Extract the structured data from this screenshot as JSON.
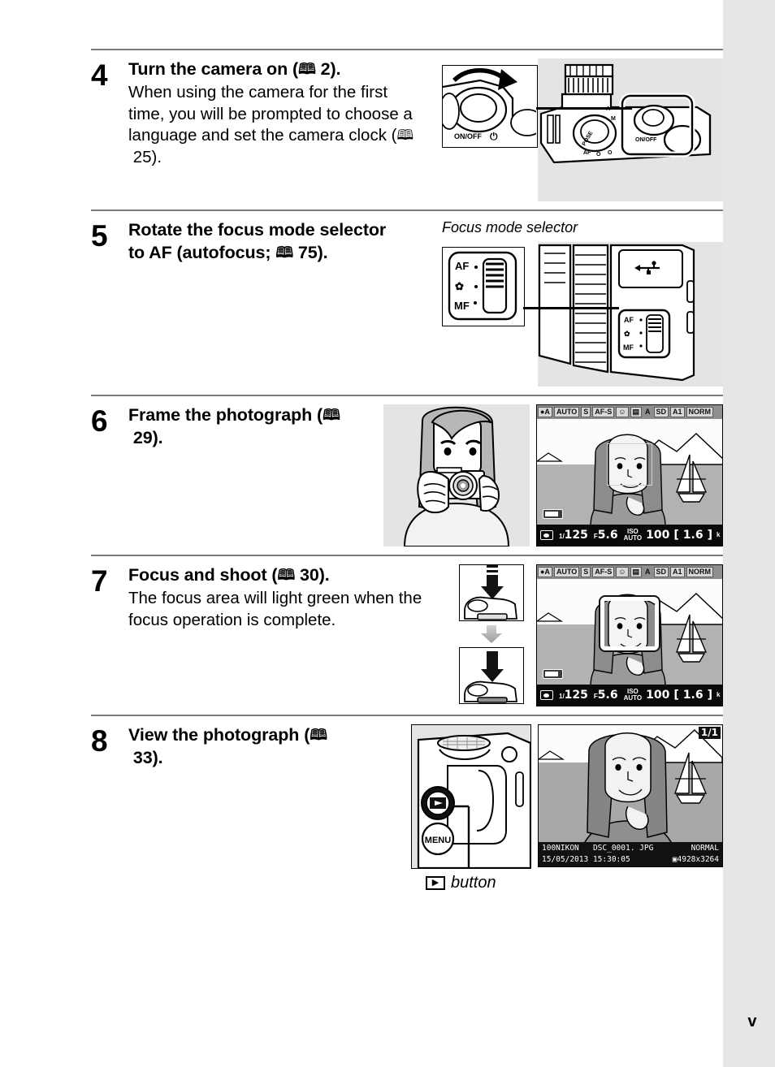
{
  "page": {
    "number": "v",
    "margin_color": "#e6e6e6"
  },
  "steps": [
    {
      "number": "4",
      "heading": "Turn the camera on (",
      "heading_ref": "2",
      "heading_tail": ").",
      "body": "When using the camera for the first time, you will be prompted to choose a language and set the camera clock (",
      "body_ref": "25",
      "body_tail": ").",
      "figure_caption": "",
      "figure": {
        "name": "camera-top-power-switch",
        "callout_label": "ON/OFF",
        "mode_dial_marks": "AUTO M S A"
      }
    },
    {
      "number": "5",
      "heading": "Rotate the focus mode selector to AF (autofocus; ",
      "heading_ref": "75",
      "heading_tail": ").",
      "body": "",
      "body_ref": "",
      "body_tail": "",
      "figure_caption": "Focus mode selector",
      "figure": {
        "name": "focus-mode-selector",
        "positions": [
          "AF",
          "macro",
          "MF"
        ],
        "usb_icon": "usb-icon"
      }
    },
    {
      "number": "6",
      "heading": "Frame the photograph (",
      "heading_ref": "29",
      "heading_tail": ").",
      "body": "",
      "body_ref": "",
      "body_tail": "",
      "figure_caption": "",
      "figure": {
        "name": "framing-photographer-and-live-view"
      }
    },
    {
      "number": "7",
      "heading": "Focus and shoot (",
      "heading_ref": "30",
      "heading_tail": ").",
      "body": "The focus area will light green when the focus operation is complete.",
      "body_ref": "",
      "body_tail": "",
      "figure_caption": "",
      "figure": {
        "name": "shutter-release-press-and-live-view"
      }
    },
    {
      "number": "8",
      "heading": "View the photograph (",
      "heading_ref": "33",
      "heading_tail": ").",
      "body": "",
      "body_ref": "",
      "body_tail": "",
      "figure_caption": "",
      "figure": {
        "name": "playback-button-and-image-review",
        "button_label": "button",
        "menu_button_label": "MENU"
      }
    }
  ],
  "live_view": {
    "status_icons": [
      {
        "name": "auto-mode-icon",
        "label": "AUTO"
      },
      {
        "name": "flash-auto-icon",
        "label": "AUTO"
      },
      {
        "name": "release-mode-single-icon",
        "label": "S"
      },
      {
        "name": "focus-mode-af-s-icon",
        "label": "AF-S"
      },
      {
        "name": "face-detection-icon",
        "label": ""
      },
      {
        "name": "af-area-mode-icon",
        "label": ""
      },
      {
        "name": "metering-auto-icon",
        "label": "A"
      },
      {
        "name": "memory-card-sd-icon",
        "label": "SD"
      },
      {
        "name": "white-balance-auto-icon",
        "label": "A1"
      },
      {
        "name": "image-quality-icon",
        "label": "NORM"
      }
    ],
    "bottom_bar": {
      "metering_icon": "metering-icon",
      "shutter_speed_prefix": "1/",
      "shutter_speed": "125",
      "aperture_prefix": "F",
      "aperture": "5.6",
      "iso_label": "ISO",
      "iso_auto": "AUTO",
      "iso_value": "100",
      "shots_open": "[",
      "shots_remaining": "1.6",
      "shots_close": "]",
      "shots_unit": "k"
    },
    "battery_icon": "battery-icon"
  },
  "playback": {
    "frame_counter": "1/1",
    "folder": "100NIKON",
    "filename": "DSC_0001. JPG",
    "quality": "NORMAL",
    "date": "15/05/2013",
    "time": "15:30:05",
    "size_icon": "image-size-icon",
    "dimensions": "4928x3264"
  },
  "focus_selector": {
    "af_label": "AF",
    "macro_label": "macro-flower-icon",
    "mf_label": "MF"
  },
  "power_switch": {
    "label": "ON/OFF"
  }
}
